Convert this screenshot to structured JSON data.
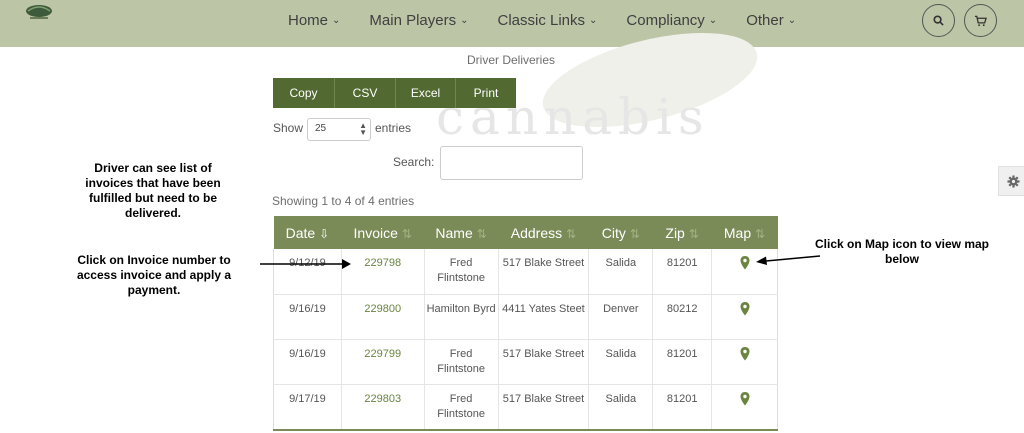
{
  "nav": {
    "menu": [
      {
        "label": "Home",
        "name": "nav-item-home"
      },
      {
        "label": "Main Players",
        "name": "nav-item-main-players"
      },
      {
        "label": "Classic Links",
        "name": "nav-item-classic-links"
      },
      {
        "label": "Compliancy",
        "name": "nav-item-compliancy"
      },
      {
        "label": "Other",
        "name": "nav-item-other"
      }
    ],
    "chevron": "⌄",
    "icons": {
      "search": "search-icon",
      "cart": "cart-icon"
    }
  },
  "watermark": "cannabis",
  "page_title": "Driver Deliveries",
  "export_buttons": [
    "Copy",
    "CSV",
    "Excel",
    "Print"
  ],
  "length": {
    "show_label": "Show",
    "selected": "25",
    "entries_label": "entries"
  },
  "search": {
    "label": "Search:",
    "value": ""
  },
  "info": "Showing 1 to 4 of 4 entries",
  "table": {
    "columns": [
      "Date",
      "Invoice",
      "Name",
      "Address",
      "City",
      "Zip",
      "Map"
    ],
    "rows": [
      [
        "9/12/19",
        "229798",
        "Fred Flintstone",
        "517 Blake Street",
        "Salida",
        "81201"
      ],
      [
        "9/16/19",
        "229800",
        "Hamilton Byrd",
        "4411 Yates Steet",
        "Denver",
        "80212"
      ],
      [
        "9/16/19",
        "229799",
        "Fred Flintstone",
        "517 Blake Street",
        "Salida",
        "81201"
      ],
      [
        "9/17/19",
        "229803",
        "Fred Flintstone",
        "517 Blake Street",
        "Salida",
        "81201"
      ]
    ]
  },
  "annotations": {
    "list": "Driver can see list of invoices that have been fulfilled but need to be delivered.",
    "invoice": "Click on Invoice number to access invoice and apply a payment.",
    "map": "Click on Map icon to view map below"
  },
  "colors": {
    "nav": "#bcc6a7",
    "button": "#526a31",
    "table_header": "#7b8b58",
    "link": "#6a8540"
  }
}
